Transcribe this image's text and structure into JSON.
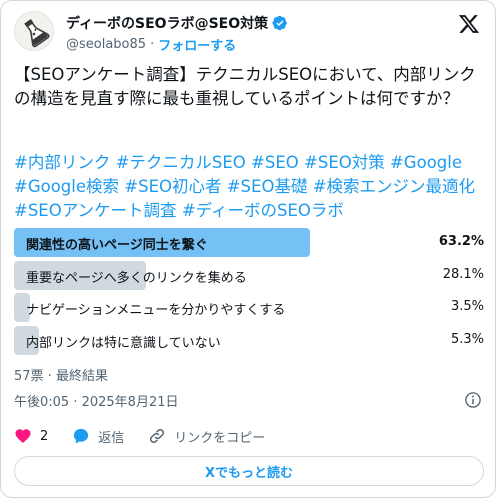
{
  "author": {
    "name": "ディーボのSEOラボ@SEO対策",
    "handle": "@seolabo85",
    "separator": "·",
    "follow_label": "フォローする"
  },
  "tweet": {
    "text": "【SEOアンケート調査】テクニカルSEOにおいて、内部リンクの構造を見直す際に最も重視しているポイントは何ですか？",
    "hashtags": [
      "#内部リンク",
      "#テクニカルSEO",
      "#SEO",
      "#SEO対策",
      "#Google",
      "#Google検索",
      "#SEO初心者",
      "#SEO基礎",
      "#検索エンジン最適化",
      "#SEOアンケート調査",
      "#ディーボのSEOラボ"
    ]
  },
  "poll": {
    "options": [
      {
        "label": "関連性の高いページ同士を繋ぐ",
        "percent": "63.2%",
        "value": 63.2,
        "winner": true
      },
      {
        "label": "重要なページへ多くのリンクを集める",
        "percent": "28.1%",
        "value": 28.1,
        "winner": false
      },
      {
        "label": "ナビゲーションメニューを分かりやすくする",
        "percent": "3.5%",
        "value": 3.5,
        "winner": false
      },
      {
        "label": "内部リンクは特に意識していない",
        "percent": "5.3%",
        "value": 5.3,
        "winner": false
      }
    ],
    "summary": "57票 · 最終結果"
  },
  "timestamp": "午後0:05 · 2025年8月21日",
  "actions": {
    "like_count": "2",
    "reply_label": "返信",
    "copy_link_label": "リンクをコピー"
  },
  "read_more_label": "Xでもっと読む",
  "colors": {
    "accent": "#1d9bf0",
    "winner_bar": "#75c0f4",
    "bar": "#cfd9de",
    "like": "#f91880",
    "verified": "#1d9bf0"
  },
  "icons": [
    "avatar-flask-icon",
    "verified-badge-icon",
    "x-logo-icon",
    "info-icon",
    "heart-icon",
    "reply-icon",
    "link-icon"
  ]
}
